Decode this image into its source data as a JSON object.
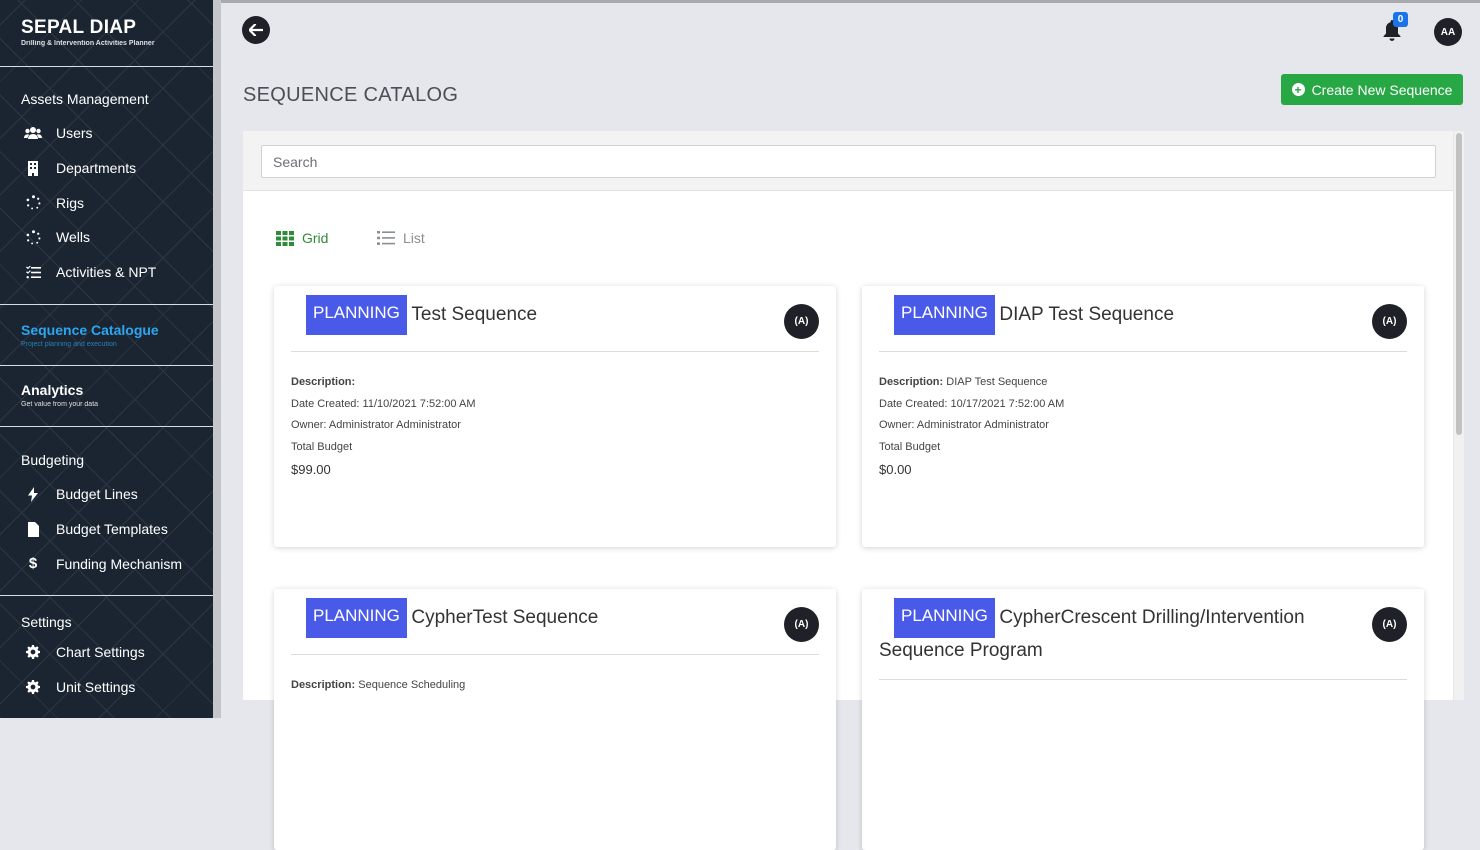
{
  "brand": {
    "title": "SEPAL DIAP",
    "subtitle": "Drilling & Intervention Activities Planner"
  },
  "sidebar": {
    "assets": {
      "heading": "Assets Management",
      "items": [
        {
          "label": "Users",
          "icon": "users-icon"
        },
        {
          "label": "Departments",
          "icon": "building-icon"
        },
        {
          "label": "Rigs",
          "icon": "spinner-icon"
        },
        {
          "label": "Wells",
          "icon": "spinner-icon"
        },
        {
          "label": "Activities & NPT",
          "icon": "list-check-icon"
        }
      ]
    },
    "sequence": {
      "heading": "Sequence Catalogue",
      "sub": "Project planning and execution"
    },
    "analytics": {
      "heading": "Analytics",
      "sub": "Get value from your data"
    },
    "budgeting": {
      "heading": "Budgeting",
      "items": [
        {
          "label": "Budget Lines",
          "icon": "bolt-icon"
        },
        {
          "label": "Budget Templates",
          "icon": "file-icon"
        },
        {
          "label": "Funding Mechanism",
          "icon": "dollar-icon"
        }
      ]
    },
    "settings": {
      "heading": "Settings",
      "items": [
        {
          "label": "Chart Settings",
          "icon": "gear-icon"
        },
        {
          "label": "Unit Settings",
          "icon": "gear-icon"
        }
      ]
    }
  },
  "header": {
    "notification_count": "0",
    "avatar_initials": "AA"
  },
  "page": {
    "title": "SEQUENCE CATALOG",
    "create_button": "Create New Sequence"
  },
  "search": {
    "placeholder": "Search"
  },
  "view": {
    "grid_label": "Grid",
    "list_label": "List"
  },
  "cards": [
    {
      "status": "PLANNING",
      "title": "Test Sequence",
      "desc_label": "Description:",
      "description": "",
      "date_created": "Date Created: 11/10/2021 7:52:00 AM",
      "owner": "Owner: Administrator Administrator",
      "budget_label": "Total Budget",
      "budget": "$99.00",
      "icon_text": "(A)"
    },
    {
      "status": "PLANNING",
      "title": "DIAP Test Sequence",
      "desc_label": "Description:",
      "description": "DIAP Test Sequence",
      "date_created": "Date Created: 10/17/2021 7:52:00 AM",
      "owner": "Owner: Administrator Administrator",
      "budget_label": "Total Budget",
      "budget": "$0.00",
      "icon_text": "(A)"
    },
    {
      "status": "PLANNING",
      "title": "CypherTest Sequence",
      "desc_label": "Description:",
      "description": "Sequence Scheduling",
      "icon_text": "(A)"
    },
    {
      "status": "PLANNING",
      "title": "CypherCrescent Drilling/Intervention Sequence Program",
      "icon_text": "(A)"
    }
  ]
}
